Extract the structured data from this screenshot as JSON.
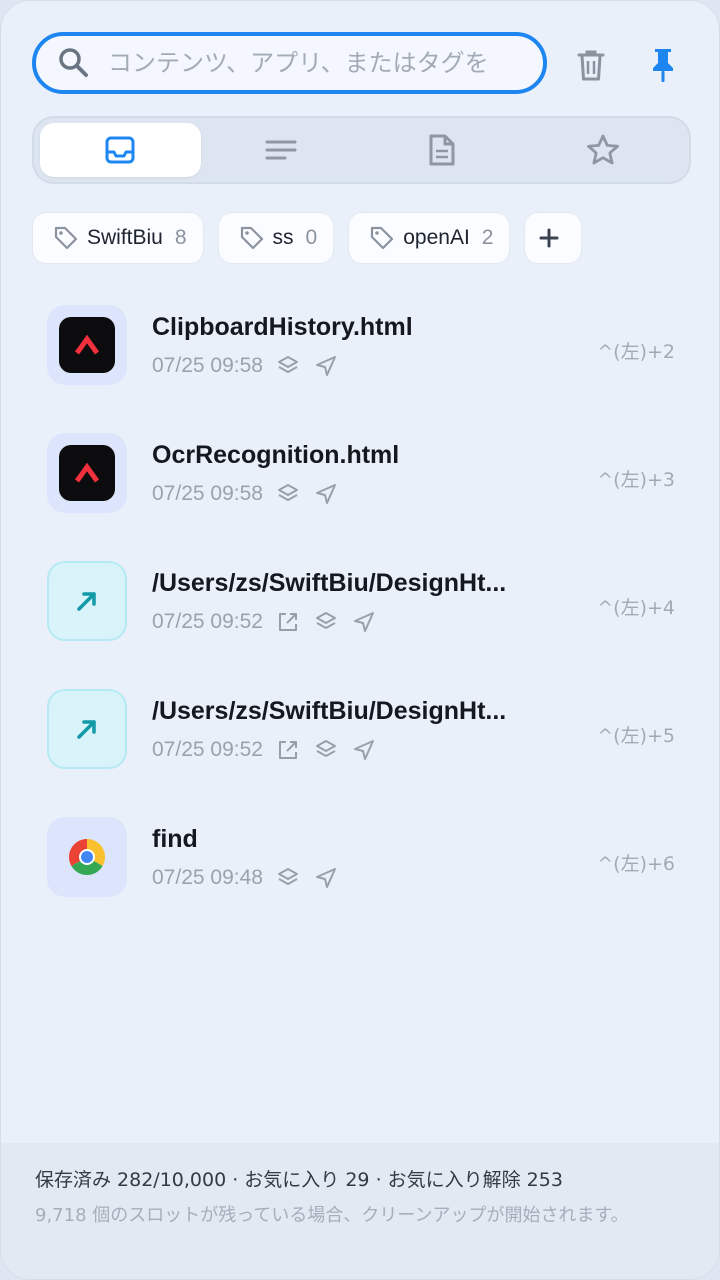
{
  "search": {
    "placeholder": "コンテンツ、アプリ、またはタグを",
    "search_icon": "magnifier-icon"
  },
  "toolbar": {
    "trash_icon": "trash-icon",
    "pin_icon": "pin-icon",
    "accent_color": "#1e86f0"
  },
  "tabs": [
    {
      "icon": "inbox-icon",
      "active": true
    },
    {
      "icon": "text-lines-icon",
      "active": false
    },
    {
      "icon": "document-icon",
      "active": false
    },
    {
      "icon": "star-icon",
      "active": false
    }
  ],
  "tags": [
    {
      "name": "SwiftBiu",
      "count": "8"
    },
    {
      "name": "ss",
      "count": "0"
    },
    {
      "name": "openAI",
      "count": "2"
    }
  ],
  "tag_add_label": "+",
  "items": [
    {
      "title": "ClipboardHistory.html",
      "time": "07/25 09:58",
      "shortcut": "^(左)+2",
      "app_icon": "red-chevron-app-icon",
      "open_external": false
    },
    {
      "title": "OcrRecognition.html",
      "time": "07/25 09:58",
      "shortcut": "^(左)+3",
      "app_icon": "red-chevron-app-icon",
      "open_external": false
    },
    {
      "title": "/Users/zs/SwiftBiu/DesignHt...",
      "time": "07/25 09:52",
      "shortcut": "^(左)+4",
      "app_icon": "link-arrow-icon",
      "open_external": true
    },
    {
      "title": "/Users/zs/SwiftBiu/DesignHt...",
      "time": "07/25 09:52",
      "shortcut": "^(左)+5",
      "app_icon": "link-arrow-icon",
      "open_external": true
    },
    {
      "title": "find",
      "time": "07/25 09:48",
      "shortcut": "^(左)+6",
      "app_icon": "chrome-icon",
      "open_external": false
    }
  ],
  "footer": {
    "stats": "保存済み 282/10,000 · お気に入り 29 · お気に入り解除 253",
    "note": "9,718 個のスロットが残っている場合、クリーンアップが開始されます。"
  }
}
